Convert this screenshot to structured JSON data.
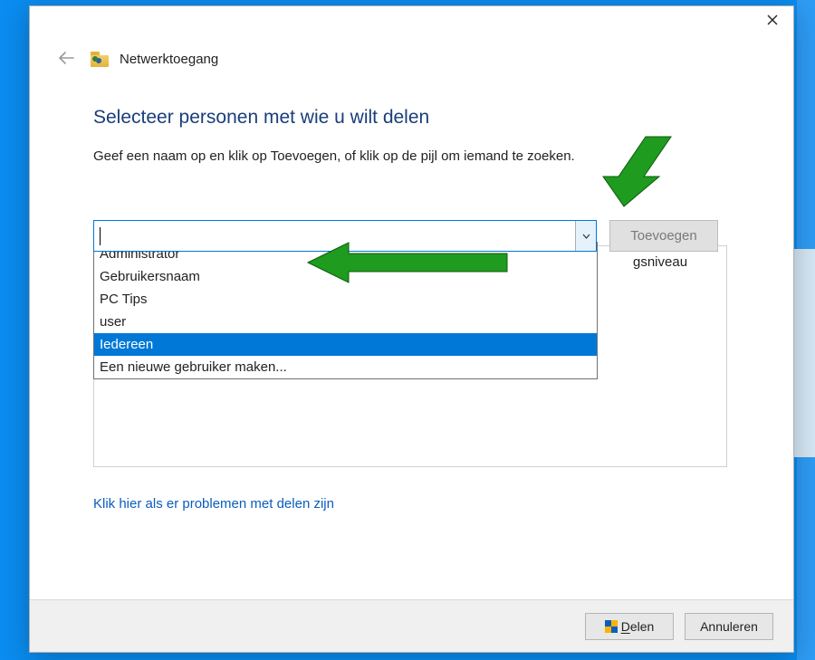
{
  "window_title": "Netwerktoegang",
  "main_heading": "Selecteer personen met wie u wilt delen",
  "instruction": "Geef een naam op en klik op Toevoegen, of klik op de pijl om iemand te zoeken.",
  "combo": {
    "value": "",
    "add_button": "Toevoegen",
    "options": [
      "Administrator",
      "Gebruikersnaam",
      "PC Tips",
      "user",
      "Iedereen",
      "Een nieuwe gebruiker maken..."
    ],
    "selected_index": 4
  },
  "table": {
    "col_permission": "gsniveau"
  },
  "problems_link": "Klik hier als er problemen met delen zijn",
  "footer": {
    "share_letter": "D",
    "share_rest": "elen",
    "cancel": "Annuleren"
  }
}
